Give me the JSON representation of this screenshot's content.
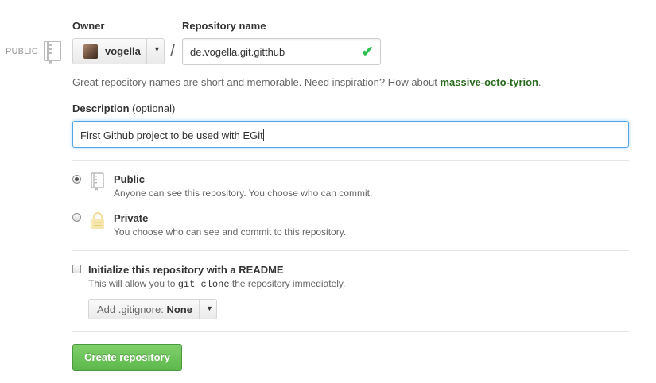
{
  "visibility_badge": "PUBLIC",
  "owner": {
    "label": "Owner",
    "name": "vogella"
  },
  "separator": "/",
  "repository": {
    "label": "Repository name",
    "value": "de.vogella.git.gitthub",
    "valid_icon": "checkmark-icon"
  },
  "hint": {
    "text": "Great repository names are short and memorable. Need inspiration? How about ",
    "suggestion": "massive-octo-tyrion",
    "end": "."
  },
  "description": {
    "label": "Description",
    "optional": "(optional)",
    "value": "First Github project to be used with EGit"
  },
  "visibility": {
    "selected": "public",
    "options": [
      {
        "id": "public",
        "title": "Public",
        "desc": "Anyone can see this repository. You choose who can commit.",
        "icon": "repo-book-icon"
      },
      {
        "id": "private",
        "title": "Private",
        "desc": "You choose who can see and commit to this repository.",
        "icon": "lock-icon"
      }
    ]
  },
  "readme": {
    "title": "Initialize this repository with a README",
    "desc_before": "This will allow you to ",
    "desc_code": "git clone",
    "desc_after": " the repository immediately.",
    "checked": false
  },
  "gitignore": {
    "prefix": "Add .gitignore:",
    "value": "None"
  },
  "submit": {
    "label": "Create repository"
  },
  "colors": {
    "accent": "#2a6a1f",
    "button": "#5cb84c",
    "focus": "#51a7e8",
    "valid": "#2cbe4e"
  }
}
